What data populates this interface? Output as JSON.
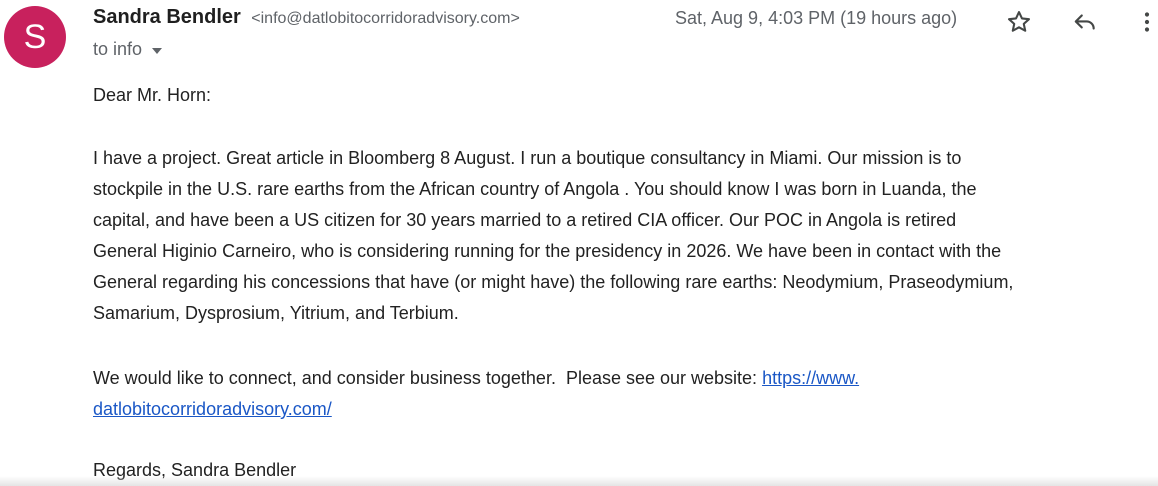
{
  "sender": {
    "avatar_letter": "S",
    "avatar_color": "#c8215d",
    "name": "Sandra Bendler",
    "email": "<info@datlobitocorridoradvisory.com>"
  },
  "recipient_label": "to info",
  "date": "Sat, Aug 9, 4:03 PM (19 hours ago)",
  "icons": {
    "star": "star-outline-icon",
    "reply": "reply-icon",
    "more": "more-vertical-icon"
  },
  "body": {
    "greeting": "Dear Mr. Horn:",
    "paragraph1_lines": [
      "I have a project. Great article in Bloomberg 8 August. I run a boutique consultancy in Miami. Our mission is to",
      "stockpile in the U.S. rare earths from the African country of Angola . You should know I was born in Luanda, the",
      "capital, and have been a US citizen for 30 years married to a retired CIA officer.  Our POC in Angola is retired",
      "General Higinio Carneiro, who is considering running for the presidency in 2026. We have been in contact with the",
      "General regarding his concessions that have (or might have) the following rare earths: Neodymium, Praseodymium,",
      "Samarium, Dysprosium, Yitrium, and Terbium."
    ],
    "paragraph2_text": "We would like to connect, and consider business together.  Please see our website: ",
    "link_line1": "https://www.",
    "link_line2": "datlobitocorridoradvisory.com/",
    "signoff": "Regards, Sandra Bendler"
  },
  "colors": {
    "link": "#1a57c6",
    "muted": "#5f6368"
  }
}
